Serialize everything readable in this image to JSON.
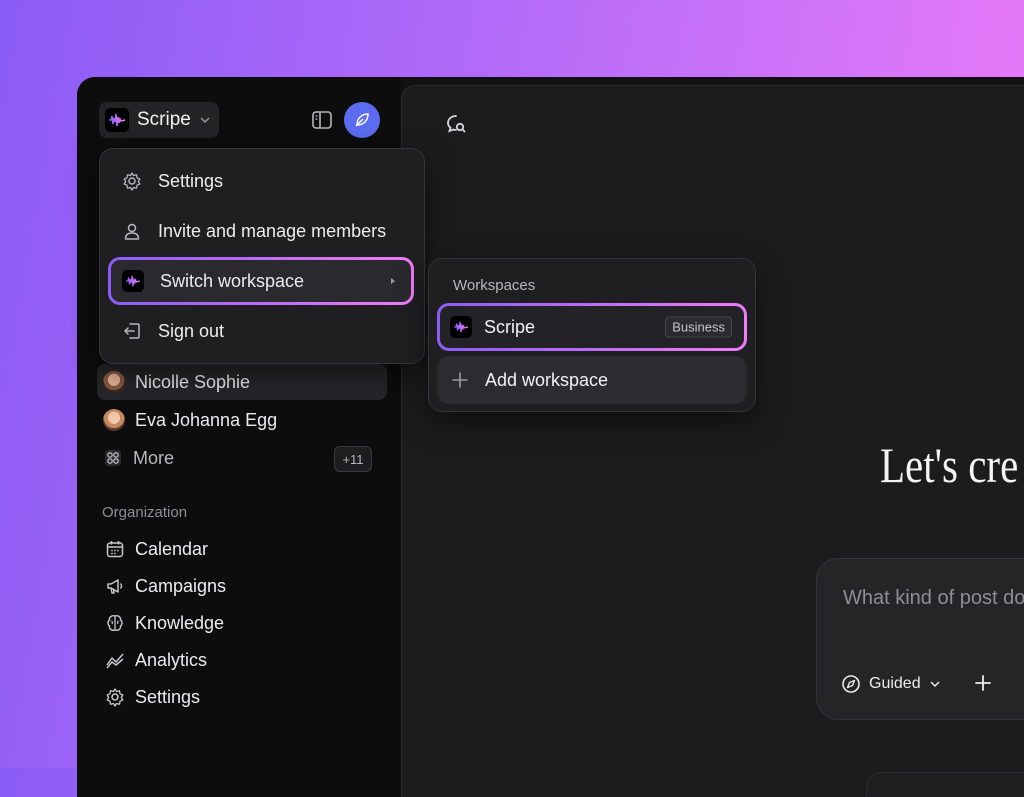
{
  "workspace": {
    "name": "Scripe"
  },
  "menu": {
    "items": [
      {
        "label": "Settings",
        "icon": "gear-icon"
      },
      {
        "label": "Invite and manage members",
        "icon": "person-icon"
      },
      {
        "label": "Switch workspace",
        "icon": "workspace-logo-icon"
      },
      {
        "label": "Sign out",
        "icon": "sign-out-icon"
      }
    ]
  },
  "submenu": {
    "title": "Workspaces",
    "workspace": {
      "name": "Scripe",
      "badge": "Business"
    },
    "add_label": "Add workspace"
  },
  "sidebar": {
    "people": [
      {
        "name": "Nicolle Sophie"
      },
      {
        "name": "Eva Johanna Egg"
      }
    ],
    "more_label": "More",
    "more_count": "+11",
    "org_label": "Organization",
    "org_items": [
      {
        "label": "Calendar",
        "icon": "calendar-icon"
      },
      {
        "label": "Campaigns",
        "icon": "megaphone-icon"
      },
      {
        "label": "Knowledge",
        "icon": "brain-icon"
      },
      {
        "label": "Analytics",
        "icon": "analytics-icon"
      },
      {
        "label": "Settings",
        "icon": "gear-icon"
      }
    ]
  },
  "main": {
    "headline": "Let's cre",
    "input_placeholder": "What kind of post do you w",
    "mode_label": "Guided"
  },
  "colors": {
    "accent_gradient_start": "#8b5cf6",
    "accent_gradient_end": "#f07cf8",
    "avatar_blue": "#5b6cf0"
  }
}
